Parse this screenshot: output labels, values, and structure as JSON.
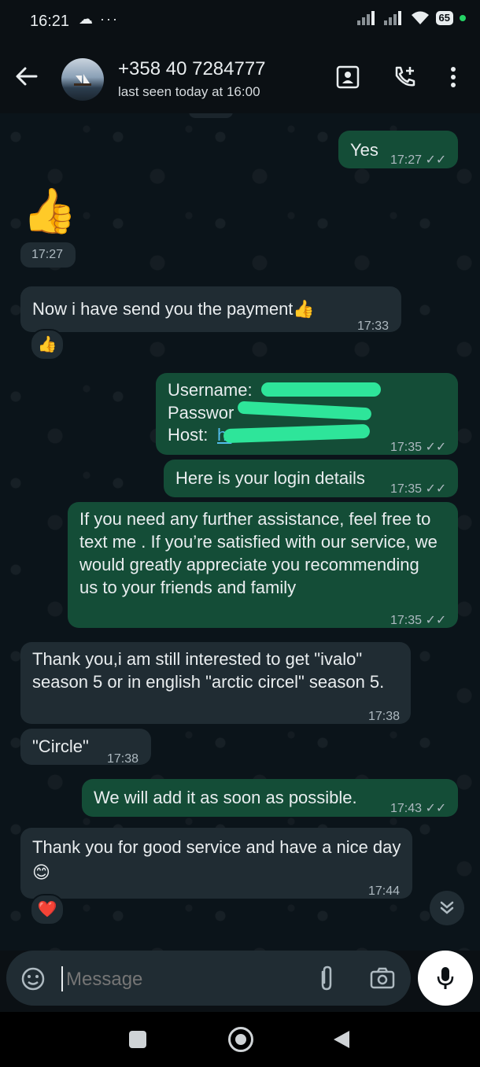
{
  "status_bar": {
    "time": "16:21",
    "left_icons": "☁ ···",
    "battery": "65"
  },
  "header": {
    "contact": "+358 40 7284777",
    "last_seen": "last seen today at 16:00"
  },
  "messages": [
    {
      "dir": "out",
      "text": "Yes",
      "time": "17:27",
      "ticks": "✓✓"
    },
    {
      "dir": "in",
      "text": "👍",
      "time": "17:27"
    },
    {
      "dir": "in",
      "text": "Now i have send you the payment👍",
      "time": "17:33",
      "reaction": "👍"
    },
    {
      "dir": "out",
      "lines": [
        "Username:",
        "Passwor",
        "Host: "
      ],
      "time": "17:35",
      "ticks": "✓✓"
    },
    {
      "dir": "out",
      "text": "Here is your login details",
      "time": "17:35",
      "ticks": "✓✓"
    },
    {
      "dir": "out",
      "text": "If you need any further assistance, feel free to text me . If you’re satisfied with our service, we would greatly appreciate you recommending us to your friends and family",
      "time": "17:35",
      "ticks": "✓✓"
    },
    {
      "dir": "in",
      "text": "Thank you,i am still interested to get \"ivalo\" season 5 or in english  \"arctic circel\" season 5.",
      "time": "17:38"
    },
    {
      "dir": "in",
      "text": "\"Circle\"",
      "time": "17:38"
    },
    {
      "dir": "out",
      "text": "We will add it as soon as possible.",
      "time": "17:43",
      "ticks": "✓✓"
    },
    {
      "dir": "in",
      "text": "Thank you for good service and have a nice day😊",
      "time": "17:44",
      "reaction": "❤️"
    }
  ],
  "composer": {
    "placeholder": "Message"
  },
  "colors": {
    "outgoing_bubble": "#144d37",
    "incoming_bubble": "#202c33",
    "background": "#0b141a",
    "link": "#53bdeb",
    "redaction": "#2ee59a"
  },
  "icons": [
    "back-arrow-icon",
    "contact-card-icon",
    "add-call-icon",
    "more-vert-icon",
    "sticker-icon",
    "attach-icon",
    "camera-icon",
    "mic-icon",
    "double-chevron-down-icon"
  ]
}
